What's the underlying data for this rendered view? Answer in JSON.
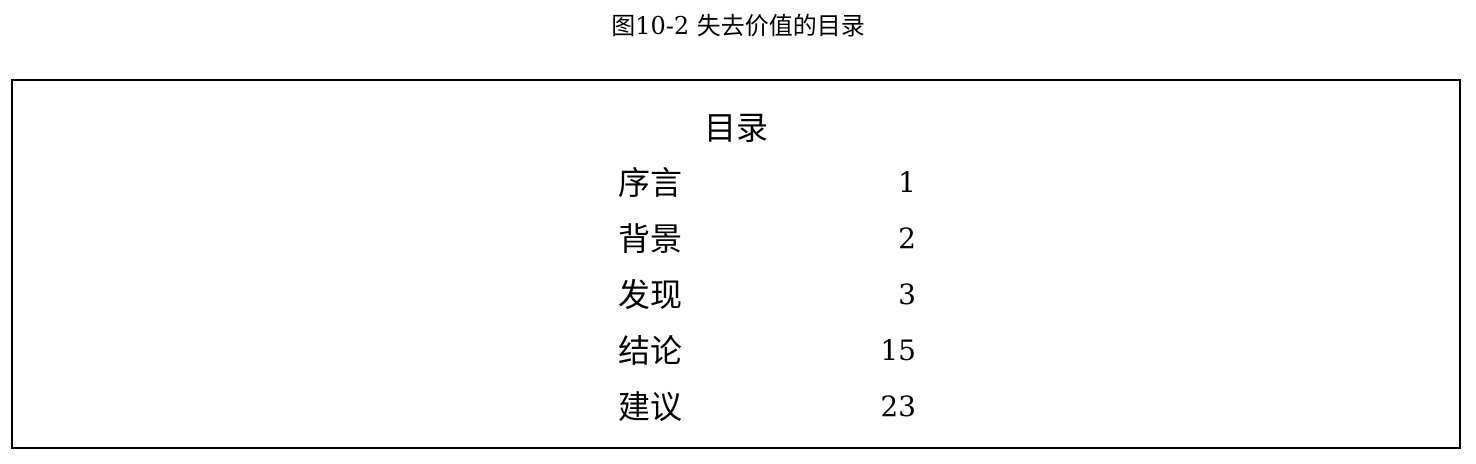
{
  "caption": "图10-2 失去价值的目录",
  "toc": {
    "heading": "目录",
    "entries": [
      {
        "label": "序言",
        "page": "1"
      },
      {
        "label": "背景",
        "page": "2"
      },
      {
        "label": "发现",
        "page": "3"
      },
      {
        "label": "结论",
        "page": "15"
      },
      {
        "label": "建议",
        "page": "23"
      }
    ]
  }
}
